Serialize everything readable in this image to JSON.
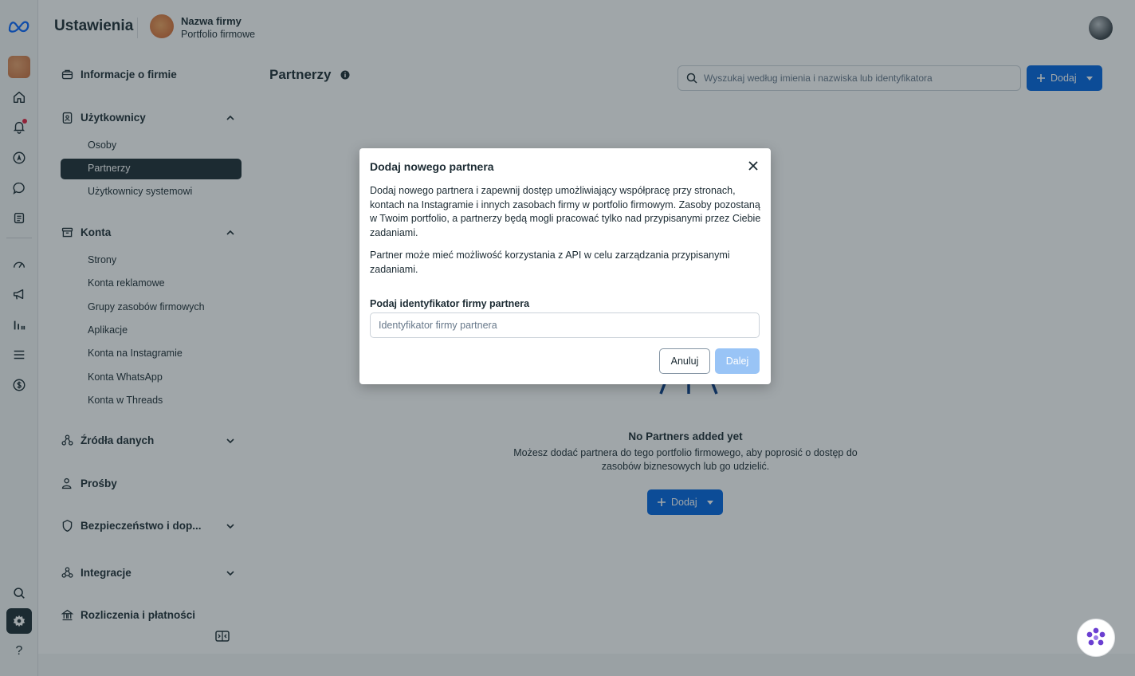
{
  "header": {
    "app_title": "Ustawienia",
    "business_name": "Nazwa firmy",
    "business_subtitle": "Portfolio firmowe"
  },
  "sidebar": {
    "sections": [
      {
        "label": "Informacje o firmie",
        "icon": "briefcase-icon"
      },
      {
        "label": "Użytkownicy",
        "icon": "user-badge-icon",
        "expanded": true,
        "items": [
          "Osoby",
          "Partnerzy",
          "Użytkownicy systemowi"
        ]
      },
      {
        "label": "Konta",
        "icon": "archive-icon",
        "expanded": true,
        "items": [
          "Strony",
          "Konta reklamowe",
          "Grupy zasobów firmowych",
          "Aplikacje",
          "Konta na Instagramie",
          "Konta WhatsApp",
          "Konta w Threads"
        ]
      },
      {
        "label": "Źródła danych",
        "icon": "people-tree-icon",
        "expanded": false
      },
      {
        "label": "Prośby",
        "icon": "person-request-icon"
      },
      {
        "label": "Bezpieczeństwo i dop...",
        "icon": "shield-icon",
        "expanded": false
      },
      {
        "label": "Integracje",
        "icon": "integration-icon",
        "expanded": false
      },
      {
        "label": "Rozliczenia i płatności",
        "icon": "bank-icon"
      }
    ],
    "active_item": "Partnerzy"
  },
  "main": {
    "title": "Partnerzy",
    "search_placeholder": "Wyszukaj według imienia i nazwiska lub identyfikatora",
    "add_label": "Dodaj",
    "empty_title": "No Partners added yet",
    "empty_desc": "Możesz dodać partnera do tego portfolio firmowego, aby poprosić o dostęp do zasobów biznesowych lub go udzielić.",
    "empty_add_label": "Dodaj"
  },
  "modal": {
    "title": "Dodaj nowego partnera",
    "paragraph1": "Dodaj nowego partnera i zapewnij dostęp umożliwiający współpracę przy stronach, kontach na Instagramie i innych zasobach firmy w portfolio firmowym. Zasoby pozostaną w Twoim portfolio, a partnerzy będą mogli pracować tylko nad przypisanymi przez Ciebie zadaniami.",
    "paragraph2": "Partner może mieć możliwość korzystania z API w celu zarządzania przypisanymi zadaniami.",
    "field_label": "Podaj identyfikator firmy partnera",
    "field_placeholder": "Identyfikator firmy partnera",
    "field_value": "",
    "cancel_label": "Anuluj",
    "next_label": "Dalej"
  },
  "colors": {
    "primary": "#0064e0",
    "primary_disabled": "#99c4f6",
    "text": "#1c2b33",
    "nav_active": "#1c2b33",
    "notification": "#e41e3f"
  }
}
